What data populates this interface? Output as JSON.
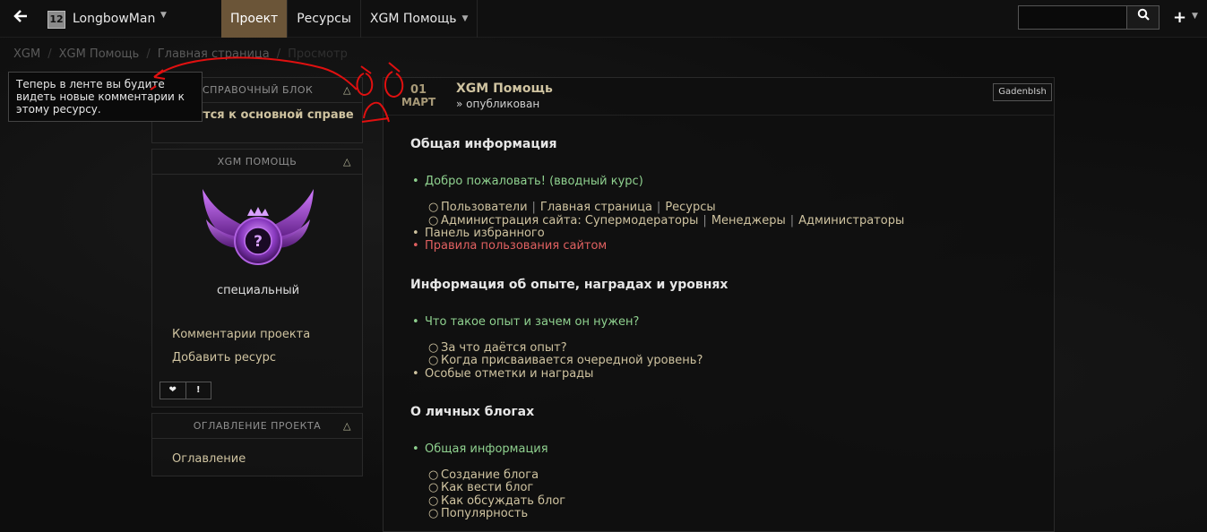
{
  "topbar": {
    "back_icon": "arrow-left-icon",
    "user_avatar_text": "12",
    "user_name": "LongbowMan",
    "nav": [
      {
        "label": "Проект",
        "active": true
      },
      {
        "label": "Ресурсы",
        "active": false
      },
      {
        "label": "XGM Помощь",
        "active": false
      }
    ],
    "search_placeholder": "",
    "search_icon": "search-icon",
    "plus_icon": "plus-icon"
  },
  "breadcrumbs": [
    "XGM",
    "XGM Помощь",
    "Главная страница",
    "Просмотр"
  ],
  "tooltip": "Теперь в ленте вы будите видеть новые комментарии к этому ресурсу.",
  "sidebar": {
    "panel1": {
      "title": "СПРАВОЧНЫЙ БЛОК",
      "body": "...ротутся к основной справе"
    },
    "panel2": {
      "title": "XGM ПОМОЩЬ",
      "caption": "специальный",
      "link1": "Комментарии проекта",
      "link2": "Добавить ресурс",
      "btn_like": "❤",
      "btn_report": "!"
    },
    "panel3": {
      "title": "ОГЛАВЛЕНИЕ ПРОЕКТА",
      "link": "Оглавление"
    }
  },
  "main": {
    "date_day": "01",
    "date_month": "МАРТ",
    "title": "XGM Помощь",
    "subtitle": "» опубликован",
    "author": "GadenbIsh",
    "sections": [
      {
        "heading": "Общая информация",
        "items": [
          {
            "text": "Добро пожаловать! (вводный курс)",
            "color": "green"
          },
          {
            "sub": [
              "Пользователи",
              "Главная страница",
              "Ресурсы"
            ]
          },
          {
            "sub_prefix": "Администрация сайта: ",
            "sub": [
              "Супермодераторы",
              "Менеджеры",
              "Администраторы"
            ]
          },
          {
            "text": "Панель избранного",
            "color": "gold"
          },
          {
            "text": "Правила пользования сайтом",
            "color": "red"
          }
        ]
      },
      {
        "heading": "Информация об опыте, наградах и уровнях",
        "items": [
          {
            "text": "Что такое опыт и зачем он нужен?",
            "color": "green"
          },
          {
            "sub_single": "За что даётся опыт?"
          },
          {
            "sub_single": "Когда присваивается очередной уровень?"
          },
          {
            "text": "Особые отметки и награды",
            "color": "gold"
          }
        ]
      },
      {
        "heading": "О личных блогах",
        "items": [
          {
            "text": "Общая информация",
            "color": "green"
          },
          {
            "sub_single": "Создание блога"
          },
          {
            "sub_single": "Как вести блог"
          },
          {
            "sub_single": "Как обсуждать блог"
          },
          {
            "sub_single": "Популярность"
          }
        ]
      }
    ]
  },
  "colors": {
    "accent": "#6b5538",
    "link_gold": "#cfc3a0",
    "link_green": "#8fd18f",
    "link_red": "#e06060",
    "annotation_red": "#e01010"
  }
}
